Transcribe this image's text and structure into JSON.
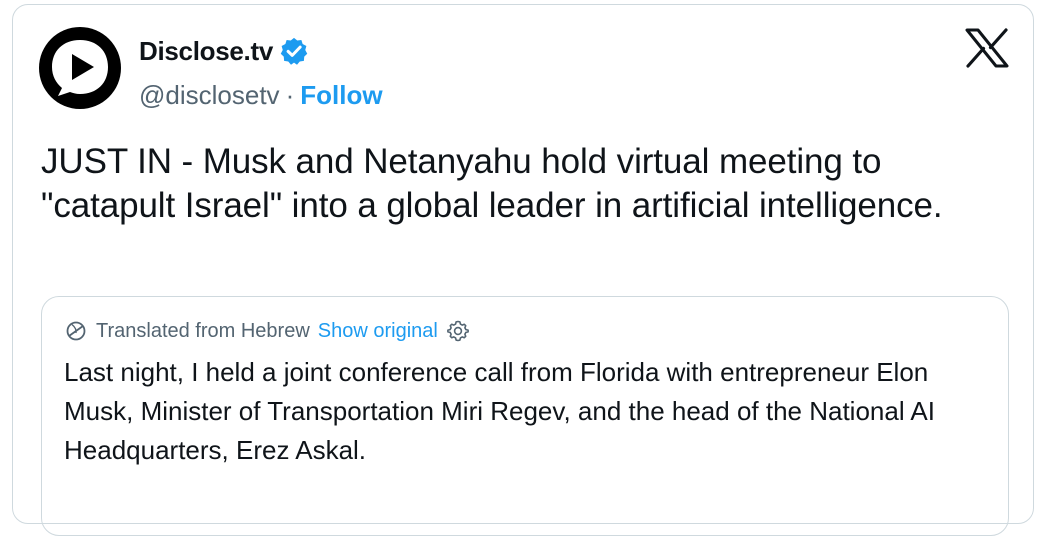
{
  "post": {
    "author": {
      "name": "Disclose.tv",
      "handle": "@disclosetv",
      "separator": "·",
      "follow_label": "Follow",
      "verified": true,
      "avatar_icon": "play-bubble-icon"
    },
    "platform_icon": "x-logo-icon",
    "text": "JUST IN - Musk and Netanyahu hold virtual meeting to \"catapult Israel\" into a global leader in artificial intelligence.",
    "quote": {
      "translated_label": "Translated from Hebrew",
      "show_original_label": "Show original",
      "text": "Last night, I held a joint conference call from Florida with entrepreneur Elon Musk, Minister of Transportation Miri Regev, and the head of the National AI Headquarters, Erez Askal."
    }
  },
  "colors": {
    "accent": "#1d9bf0",
    "text_primary": "#0f1419",
    "text_secondary": "#536471",
    "border": "#cfd9de"
  }
}
